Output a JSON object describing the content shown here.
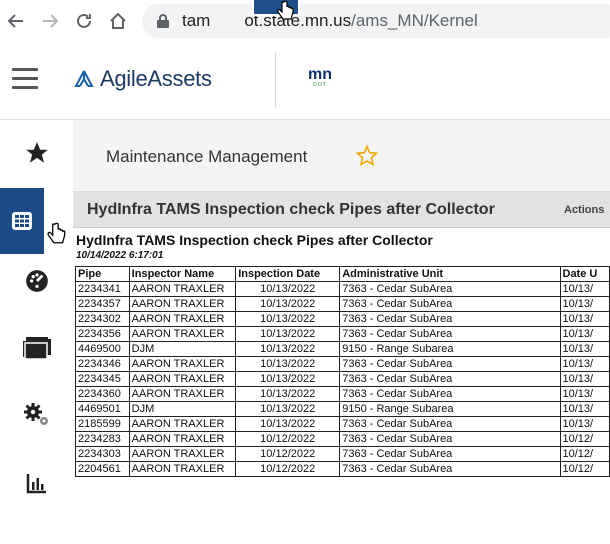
{
  "browser": {
    "url_host": "tam",
    "url_rest": "ot.state.mn.us",
    "url_path": "/ams_MN/Kernel"
  },
  "header": {
    "logo_text": "AgileAssets",
    "partner_logo": "mn",
    "partner_sub": "DOT"
  },
  "sidebar": {
    "items": [
      {
        "icon": "star-icon"
      },
      {
        "icon": "grid-icon",
        "active": true
      },
      {
        "icon": "dashboard-icon"
      },
      {
        "icon": "folder-icon"
      },
      {
        "icon": "settings-icon"
      },
      {
        "icon": "bar-chart-icon"
      }
    ]
  },
  "main": {
    "module_title": "Maintenance Management",
    "report_title": "HydInfra TAMS Inspection check  Pipes after Collector",
    "actions_label": "Actions"
  },
  "document": {
    "title": "HydInfra TAMS Inspection check Pipes after Collector",
    "date": "10/14/2022 6:17:01",
    "columns": [
      "Pipe",
      "Inspector Name",
      "Inspection Date",
      "Administrative Unit",
      "Date U"
    ],
    "rows": [
      [
        "2234341",
        "AARON TRAXLER",
        "10/13/2022",
        "7363 - Cedar SubArea",
        "10/13/"
      ],
      [
        "2234357",
        "AARON TRAXLER",
        "10/13/2022",
        "7363 - Cedar SubArea",
        "10/13/"
      ],
      [
        "2234302",
        "AARON TRAXLER",
        "10/13/2022",
        "7363 - Cedar SubArea",
        "10/13/"
      ],
      [
        "2234356",
        "AARON TRAXLER",
        "10/13/2022",
        "7363 - Cedar SubArea",
        "10/13/"
      ],
      [
        "4469500",
        "DJM",
        "10/13/2022",
        "9150 - Range Subarea",
        "10/13/"
      ],
      [
        "2234346",
        "AARON TRAXLER",
        "10/13/2022",
        "7363 - Cedar SubArea",
        "10/13/"
      ],
      [
        "2234345",
        "AARON TRAXLER",
        "10/13/2022",
        "7363 - Cedar SubArea",
        "10/13/"
      ],
      [
        "2234360",
        "AARON TRAXLER",
        "10/13/2022",
        "7363 - Cedar SubArea",
        "10/13/"
      ],
      [
        "4469501",
        "DJM",
        "10/13/2022",
        "9150 - Range Subarea",
        "10/13/"
      ],
      [
        "2185599",
        "AARON TRAXLER",
        "10/13/2022",
        "7363 - Cedar SubArea",
        "10/13/"
      ],
      [
        "2234283",
        "AARON TRAXLER",
        "10/12/2022",
        "7363 - Cedar SubArea",
        "10/12/"
      ],
      [
        "2234303",
        "AARON TRAXLER",
        "10/12/2022",
        "7363 - Cedar SubArea",
        "10/12/"
      ],
      [
        "2204561",
        "AARON TRAXLER",
        "10/12/2022",
        "7363 - Cedar SubArea",
        "10/12/"
      ]
    ]
  },
  "colors": {
    "sidebar_active": "#1b4a87",
    "star_outline": "#f0a800",
    "brand_navy": "#1d3a63"
  }
}
